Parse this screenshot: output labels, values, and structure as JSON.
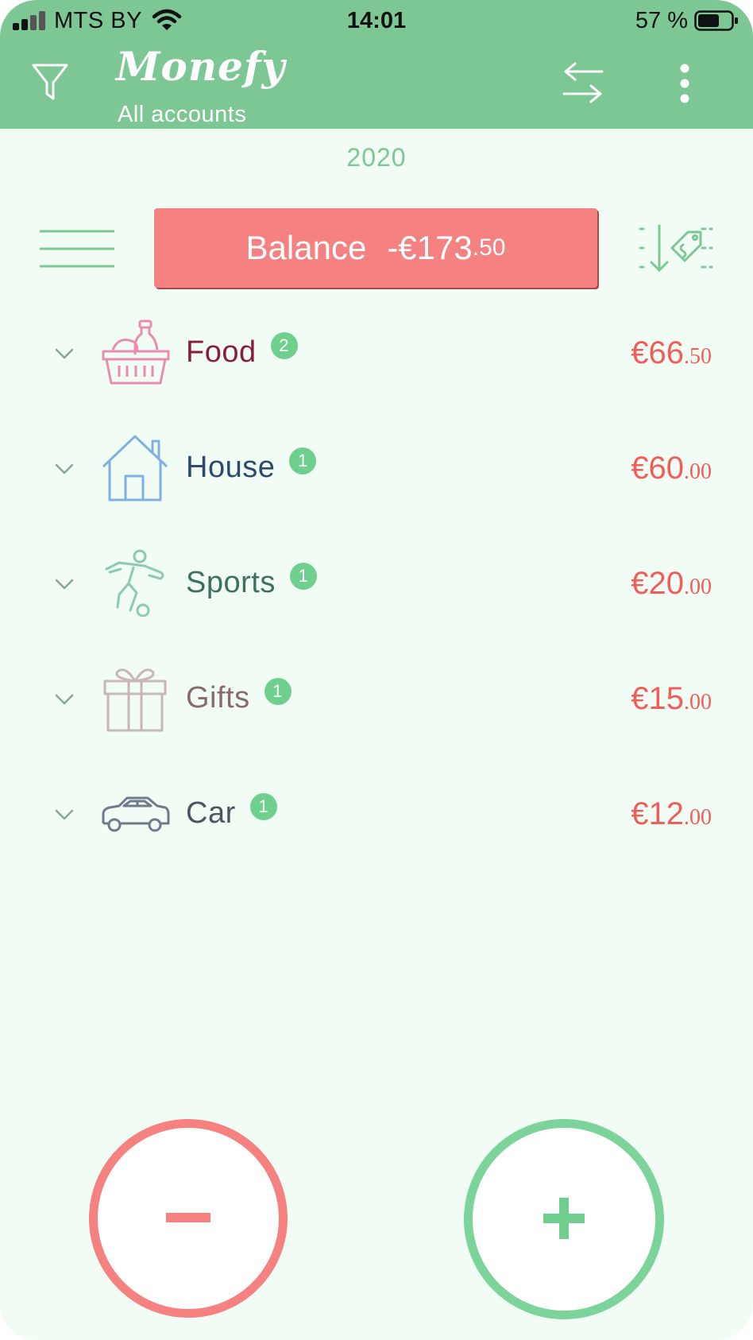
{
  "status_bar": {
    "carrier": "MTS BY",
    "time": "14:01",
    "battery": "57 %"
  },
  "app_bar": {
    "title": "Monefy",
    "subtitle": "All accounts"
  },
  "period": "2020",
  "balance": {
    "label": "Balance",
    "amount": "-€173",
    "cents": ".50"
  },
  "categories": [
    {
      "name": "Food",
      "count": "2",
      "amount": "€66",
      "cents": ".50",
      "icon": "basket-icon",
      "color": "#8a1c3c"
    },
    {
      "name": "House",
      "count": "1",
      "amount": "€60",
      "cents": ".00",
      "icon": "house-icon",
      "color": "#2d4a6e"
    },
    {
      "name": "Sports",
      "count": "1",
      "amount": "€20",
      "cents": ".00",
      "icon": "soccer-player-icon",
      "color": "#3f6f61"
    },
    {
      "name": "Gifts",
      "count": "1",
      "amount": "€15",
      "cents": ".00",
      "icon": "gift-icon",
      "color": "#8a6b6b"
    },
    {
      "name": "Car",
      "count": "1",
      "amount": "€12",
      "cents": ".00",
      "icon": "car-icon",
      "color": "#4d5563"
    }
  ],
  "colors": {
    "header": "#7dc795",
    "background": "#f1fdf4",
    "expense": "#f58280",
    "income": "#7dd49a",
    "amount": "#ef5e5a",
    "badge": "#6fcf8e"
  }
}
